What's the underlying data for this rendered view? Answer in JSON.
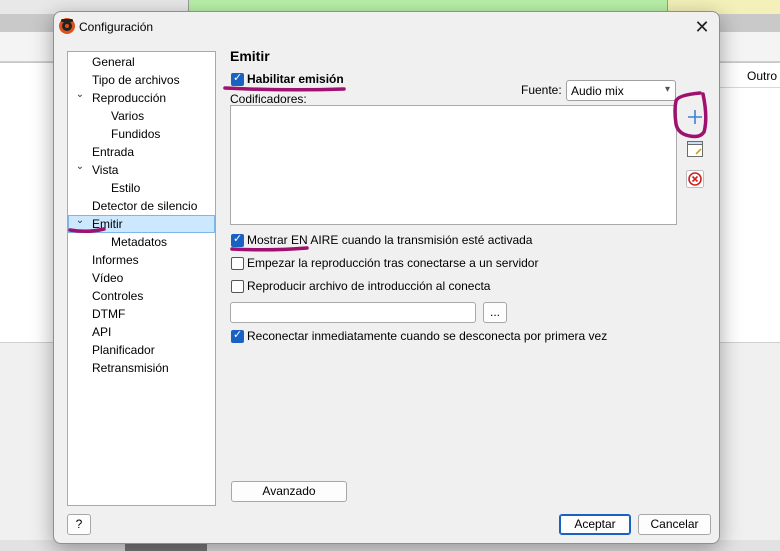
{
  "background": {
    "column_header": "Outro"
  },
  "dialog": {
    "title": "Configuración",
    "close": "✕",
    "help_label": "?",
    "ok_label": "Aceptar",
    "cancel_label": "Cancelar"
  },
  "tree": {
    "items": [
      {
        "label": "General"
      },
      {
        "label": "Tipo de archivos"
      },
      {
        "label": "Reproducción"
      },
      {
        "label": "Varios"
      },
      {
        "label": "Fundidos"
      },
      {
        "label": "Entrada"
      },
      {
        "label": "Vista"
      },
      {
        "label": "Estilo"
      },
      {
        "label": "Detector de silencio"
      },
      {
        "label": "Emitir"
      },
      {
        "label": "Metadatos"
      },
      {
        "label": "Informes"
      },
      {
        "label": "Vídeo"
      },
      {
        "label": "Controles"
      },
      {
        "label": "DTMF"
      },
      {
        "label": "API"
      },
      {
        "label": "Planificador"
      },
      {
        "label": "Retransmisión"
      }
    ],
    "selected": "Emitir"
  },
  "panel": {
    "title": "Emitir",
    "enable_label": "Habilitar emisión",
    "enable_checked": true,
    "source_label": "Fuente:",
    "source_value": "Audio mix",
    "encoders_label": "Codificadores:",
    "show_on_air_label": "Mostrar EN AIRE cuando la transmisión esté activada",
    "show_on_air_checked": true,
    "start_play_label": "Empezar la reproducción tras conectarse a un servidor",
    "start_play_checked": false,
    "intro_file_label": "Reproducir archivo de introducción al conecta",
    "intro_file_checked": false,
    "intro_file_path": "",
    "browse_label": "...",
    "reconnect_label": "Reconectar inmediatamente cuando se desconecta por primera vez",
    "reconnect_checked": true,
    "advanced_label": "Avanzado"
  },
  "icons": {
    "add": "plus-icon",
    "edit": "edit-icon",
    "remove": "remove-icon"
  },
  "colors": {
    "accent": "#1a62c2",
    "annotation": "#a0106e",
    "selection": "#cce8ff"
  }
}
